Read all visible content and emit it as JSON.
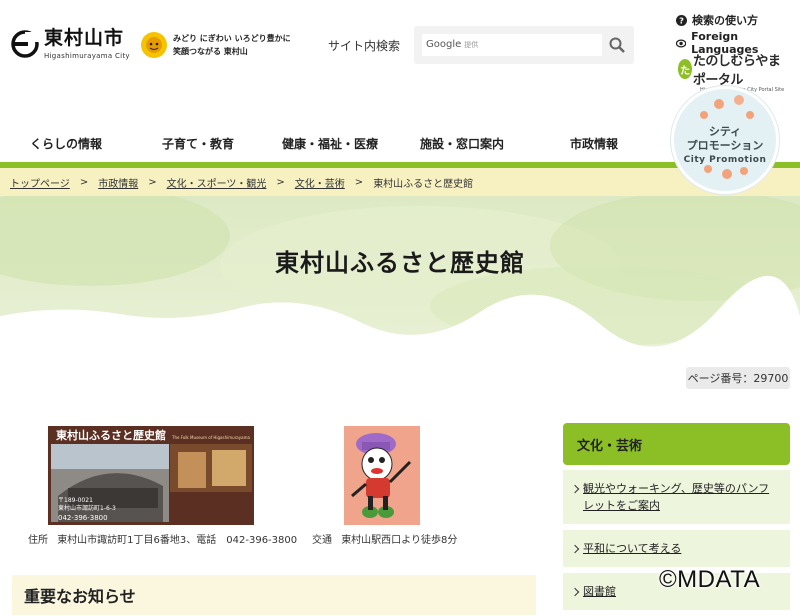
{
  "header": {
    "logo_title": "東村山市",
    "logo_subtitle": "Higashimurayama City",
    "slogan_line1": "みどり にぎわい いろどり豊かに",
    "slogan_line2": "笑顔つながる 東村山",
    "search_label": "サイト内検索",
    "search_brand": "Google",
    "search_placeholder": "提供",
    "help_link": "検索の使い方",
    "lang_link": "Foreign Languages",
    "portal_name": "たのしむらやまポータル",
    "portal_sub": "Higashimurayama City Portal Site"
  },
  "nav": {
    "items": [
      "くらしの情報",
      "子育て・教育",
      "健康・福祉・医療",
      "施設・窓口案内",
      "市政情報"
    ]
  },
  "promo": {
    "line1": "シティ",
    "line2": "プロモーション",
    "line3": "City Promotion"
  },
  "breadcrumb": [
    "トップページ",
    "市政情報",
    "文化・スポーツ・観光",
    "文化・芸術",
    "東村山ふるさと歴史館"
  ],
  "page": {
    "title": "東村山ふるさと歴史館",
    "number": "ページ番号：29700"
  },
  "photo": {
    "title": "東村山ふるさと歴史館",
    "subtitle": "The Folk Museum of Higashimurayama",
    "postal": "〒189-0021",
    "address": "東村山市諏訪町1-6-3",
    "phone": "042-396-3800"
  },
  "info": {
    "addr_label": "住所",
    "addr_value": "東村山市諏訪町1丁目6番地3、電話　042-396-3800",
    "access_label": "交通",
    "access_value": "東村山駅西口より徒歩8分"
  },
  "notice": {
    "title": "重要なお知らせ"
  },
  "sidebar": {
    "heading": "文化・芸術",
    "items": [
      "観光やウォーキング、歴史等のパンフレットをご案内",
      "平和について考える",
      "図書館"
    ]
  },
  "watermark": "©MDATA",
  "colors": {
    "accent_green": "#8cbf25",
    "breadcrumb_bg": "#f7f1c2",
    "side_item_bg": "#eef5dd"
  }
}
